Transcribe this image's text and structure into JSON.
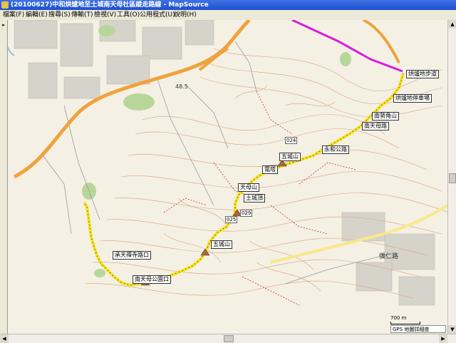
{
  "window": {
    "title": "(20100627)中和烘爐地至土城南天母社區縱走路線 - MapSource"
  },
  "menu": [
    "檔案(F)",
    "編輯(E)",
    "搜尋(S)",
    "傳輸(T)",
    "檢視(V)",
    "工具(O)",
    "公用程式(U)",
    "說明(H)"
  ],
  "waypoints": [
    {
      "id": "wp1",
      "label": "烘爐地步道"
    },
    {
      "id": "wp2",
      "label": "烘爐地停車場"
    },
    {
      "id": "wp3",
      "label": "南勢角山"
    },
    {
      "id": "wp4",
      "label": "南天母路"
    },
    {
      "id": "wp5",
      "label": "永和公路"
    },
    {
      "id": "wp6",
      "label": "五城山"
    },
    {
      "id": "wp7",
      "label": "電塔"
    },
    {
      "id": "wp8",
      "label": "天母山"
    },
    {
      "id": "wp9",
      "label": "土城頂"
    },
    {
      "id": "wp10",
      "label": "五城山"
    },
    {
      "id": "wp11",
      "label": "承天禪寺路口"
    },
    {
      "id": "wp12",
      "label": "南天母公園口"
    }
  ],
  "pins": [
    "024",
    "025",
    "029"
  ],
  "place_labels": [
    "48.5",
    "僑仁路"
  ],
  "status": {
    "scale": "700 m",
    "gps": "GPS 地圖詳細度"
  },
  "colors": {
    "track": "#f5e11d",
    "highway": "#f0a23c",
    "route": "#d81ed8",
    "contour": "#d9a27d"
  }
}
